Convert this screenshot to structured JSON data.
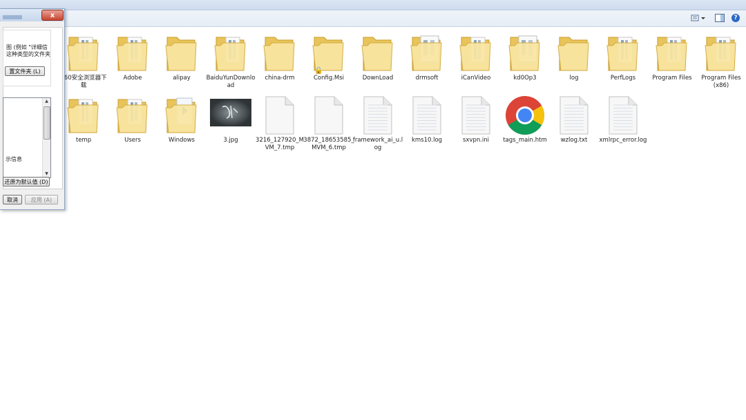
{
  "toolbar": {
    "views_icon": "views-icon",
    "preview_icon": "preview-pane-icon",
    "help_glyph": "?"
  },
  "dialog": {
    "close_glyph": "x",
    "desc_line1": "图 (例如 \"详细信",
    "desc_line2": "这种类型的文件夹",
    "apply_to_folders_label": "置文件夹 (L)",
    "list_item": "示信息",
    "restore_defaults_label": "还原为默认值 (D)",
    "cancel_label": "取消",
    "apply_label": "应用 (A)"
  },
  "items": [
    {
      "label": "360安全浏览器下载",
      "type": "folder"
    },
    {
      "label": "Adobe",
      "type": "folder"
    },
    {
      "label": "alipay",
      "type": "folder-empty"
    },
    {
      "label": "BaiduYunDownload",
      "type": "folder"
    },
    {
      "label": "china-drm",
      "type": "folder-empty"
    },
    {
      "label": "Config.Msi",
      "type": "folder-locked"
    },
    {
      "label": "DownLoad",
      "type": "folder-empty"
    },
    {
      "label": "drmsoft",
      "type": "folder-doc"
    },
    {
      "label": "iCanVideo",
      "type": "folder"
    },
    {
      "label": "kd0Op3",
      "type": "folder-doc"
    },
    {
      "label": "log",
      "type": "folder-empty"
    },
    {
      "label": "PerfLogs",
      "type": "folder"
    },
    {
      "label": "Program Files",
      "type": "folder"
    },
    {
      "label": "Program Files (x86)",
      "type": "folder"
    },
    {
      "label": "temp",
      "type": "folder"
    },
    {
      "label": "Users",
      "type": "folder"
    },
    {
      "label": "Windows",
      "type": "folder-windows"
    },
    {
      "label": "3.jpg",
      "type": "image"
    },
    {
      "label": "3216_127920_MVM_7.tmp",
      "type": "file"
    },
    {
      "label": "3872_18653585_MVM_6.tmp",
      "type": "file"
    },
    {
      "label": "framework_ai_u.log",
      "type": "text"
    },
    {
      "label": "kms10.log",
      "type": "text"
    },
    {
      "label": "sxvpn.ini",
      "type": "text"
    },
    {
      "label": "tags_main.htm",
      "type": "chrome"
    },
    {
      "label": "wzlog.txt",
      "type": "text"
    },
    {
      "label": "xmlrpc_error.log",
      "type": "text"
    }
  ],
  "colors": {
    "folder_back": "#e8c45a",
    "folder_front": "#f9e6a2",
    "chrome_red": "#db4437",
    "chrome_yellow": "#f4c20d",
    "chrome_green": "#0f9d58",
    "chrome_blue": "#4285f4"
  }
}
